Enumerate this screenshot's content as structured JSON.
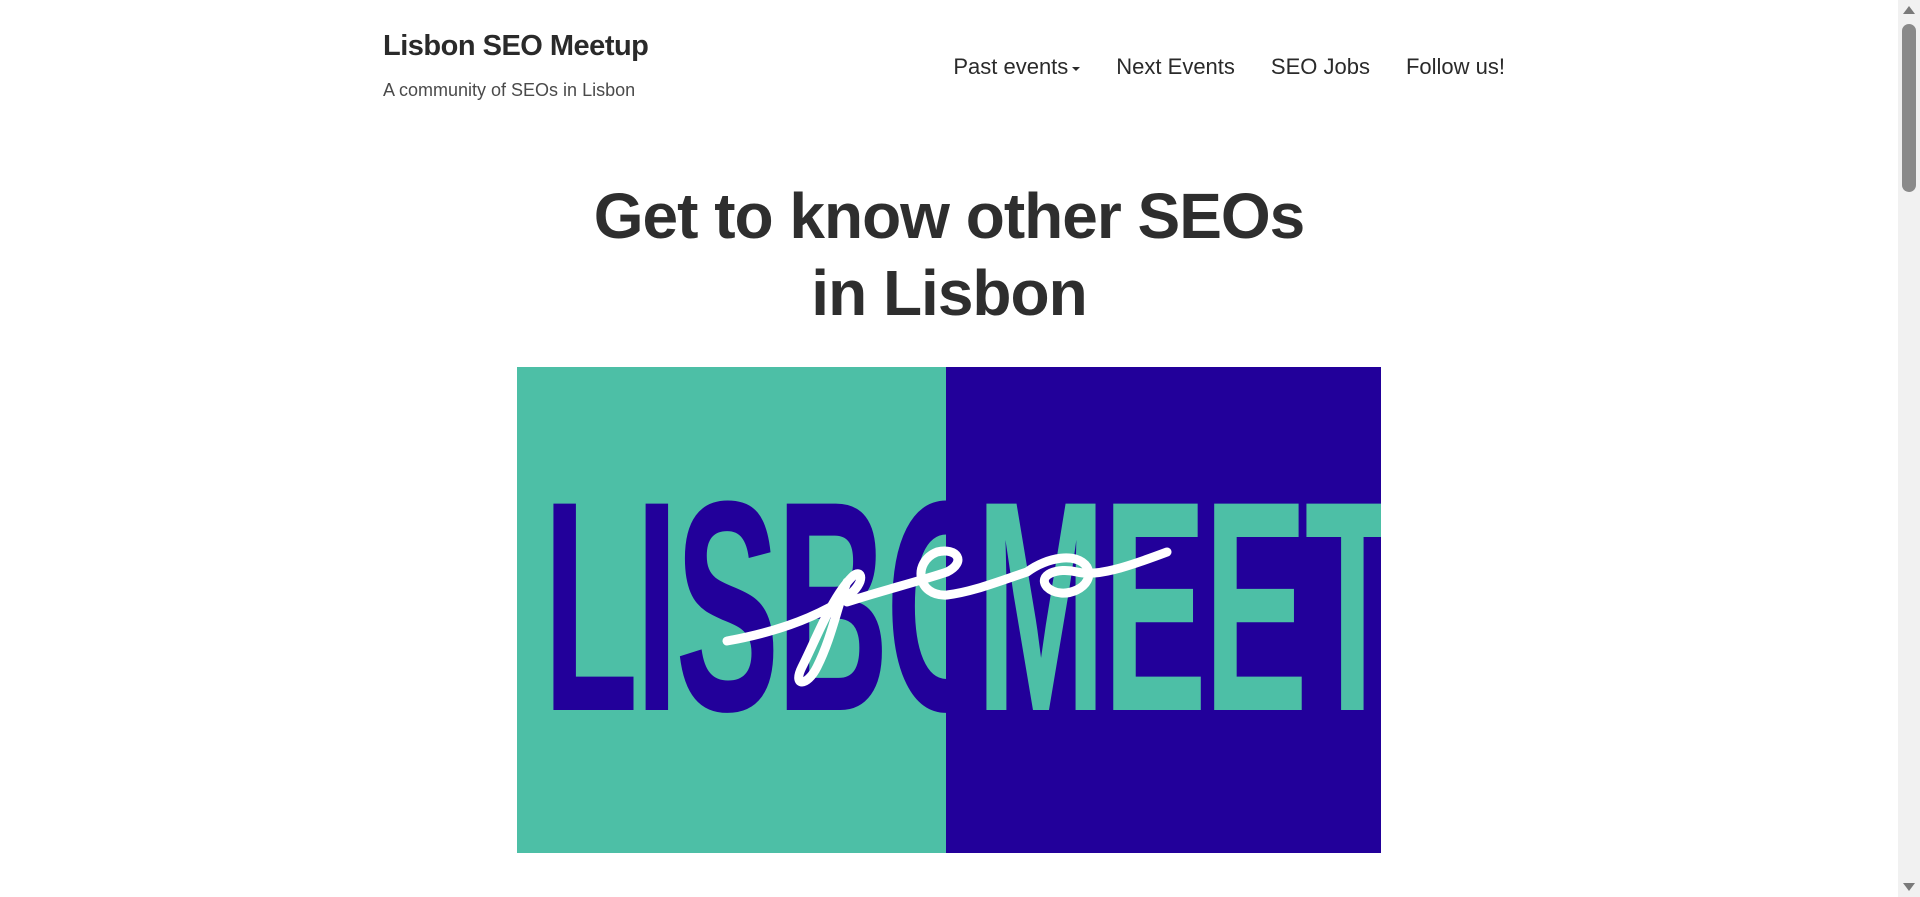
{
  "site": {
    "title": "Lisbon SEO Meetup",
    "tagline": "A community of SEOs in Lisbon"
  },
  "nav": {
    "items": [
      {
        "label": "Past events",
        "has_dropdown": true
      },
      {
        "label": "Next Events"
      },
      {
        "label": "SEO Jobs"
      },
      {
        "label": "Follow us!"
      }
    ]
  },
  "hero": {
    "heading": "Get to know other SEOs in Lisbon"
  },
  "banner": {
    "word_left": "LISBON",
    "word_right": "MEETUP",
    "script_text": "seo",
    "colors": {
      "teal": "#4dbfa6",
      "indigo": "#22009a",
      "script": "#ffffff"
    }
  }
}
